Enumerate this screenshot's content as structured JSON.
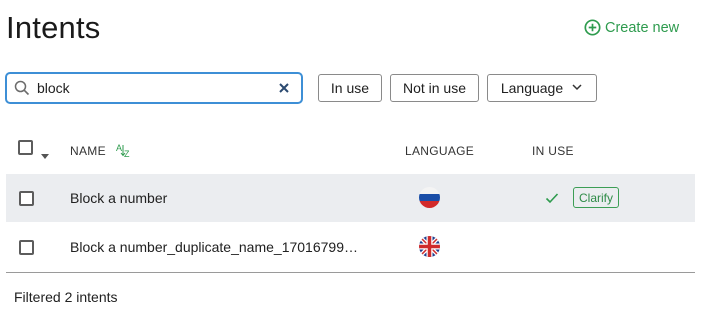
{
  "page": {
    "title": "Intents"
  },
  "header": {
    "create_label": "Create new",
    "accent": "#2e9b4e"
  },
  "search": {
    "value": "block",
    "placeholder": "",
    "focus_color": "#3d8fd6"
  },
  "filters": {
    "in_use": "In use",
    "not_in_use": "Not in use",
    "language": "Language"
  },
  "table": {
    "columns": {
      "name": "NAME",
      "language": "LANGUAGE",
      "in_use": "IN USE"
    },
    "rows": [
      {
        "name": "Block a number",
        "language_flag": "russia-flag-icon",
        "in_use": true,
        "badge": "Clarify",
        "highlighted": true
      },
      {
        "name": "Block a number_duplicate_name_17016799…",
        "language_flag": "uk-flag-icon",
        "in_use": false,
        "badge": "",
        "highlighted": false
      }
    ]
  },
  "footer": {
    "status": "Filtered 2 intents"
  }
}
